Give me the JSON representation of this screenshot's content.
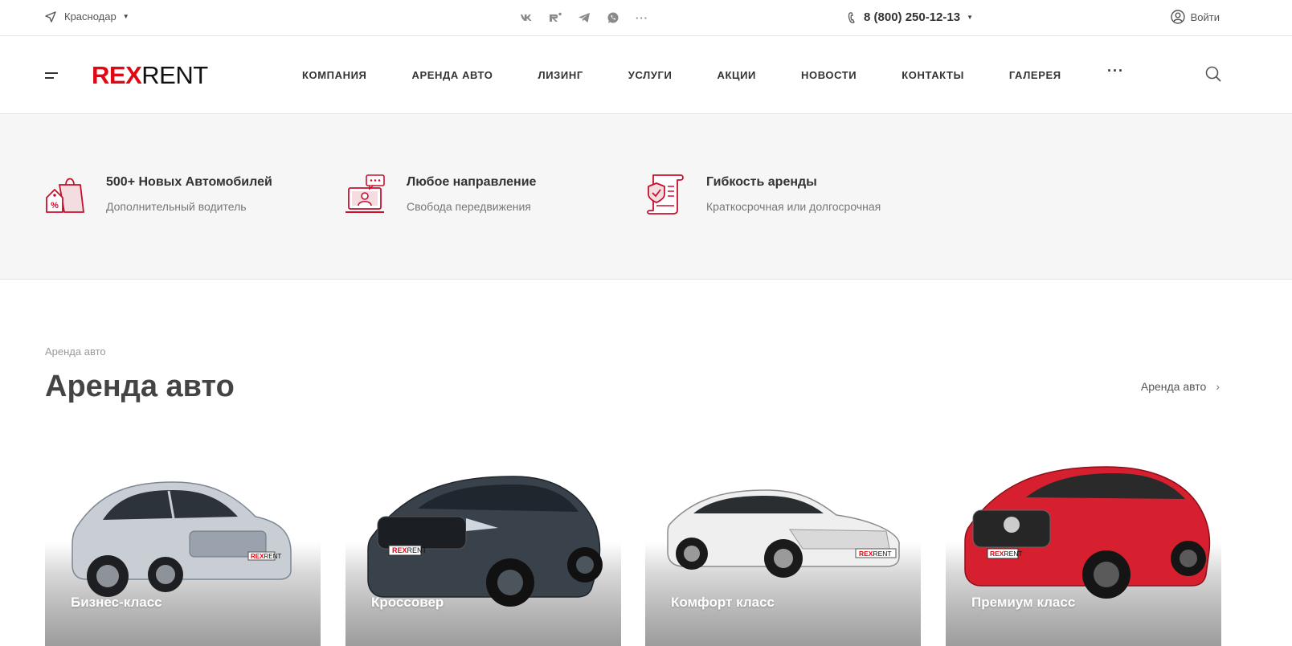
{
  "topbar": {
    "city": "Краснодар",
    "socials": [
      "vk-icon",
      "rutube-icon",
      "telegram-icon",
      "whatsapp-icon",
      "more-icon"
    ],
    "phone": "8 (800) 250-12-13",
    "login": "Войти"
  },
  "header": {
    "logo_red": "REX",
    "logo_black": "RENT",
    "nav": [
      "КОМПАНИЯ",
      "АРЕНДА АВТО",
      "ЛИЗИНГ",
      "УСЛУГИ",
      "АКЦИИ",
      "НОВОСТИ",
      "КОНТАКТЫ",
      "ГАЛЕРЕЯ"
    ],
    "more": "···"
  },
  "features": [
    {
      "icon": "shopping-bag-percent-icon",
      "title": "500+ Новых Автомобилей",
      "subtitle": "Дополнительный водитель"
    },
    {
      "icon": "laptop-person-chat-icon",
      "title": "Любое направление",
      "subtitle": "Свобода передвижения"
    },
    {
      "icon": "shield-document-icon",
      "title": "Гибкость аренды",
      "subtitle": "Краткосрочная или долгосрочная"
    }
  ],
  "section": {
    "breadcrumb": "Аренда авто",
    "title": "Аренда авто",
    "link": "Аренда авто"
  },
  "cards": [
    {
      "label": "Бизнес-класс",
      "car_color": "#c9ced4",
      "badge_red": "REX",
      "badge_black": "RENT"
    },
    {
      "label": "Кроссовер",
      "car_color": "#39414a",
      "badge_red": "REX",
      "badge_black": "RENT"
    },
    {
      "label": "Комфорт класс",
      "car_color": "#eeeeee",
      "badge_red": "REX",
      "badge_black": "RENT"
    },
    {
      "label": "Премиум класс",
      "car_color": "#d6202f",
      "badge_red": "REX",
      "badge_black": "RENT"
    }
  ],
  "colors": {
    "brand_red": "#e30613",
    "icon_red": "#c8102e"
  }
}
